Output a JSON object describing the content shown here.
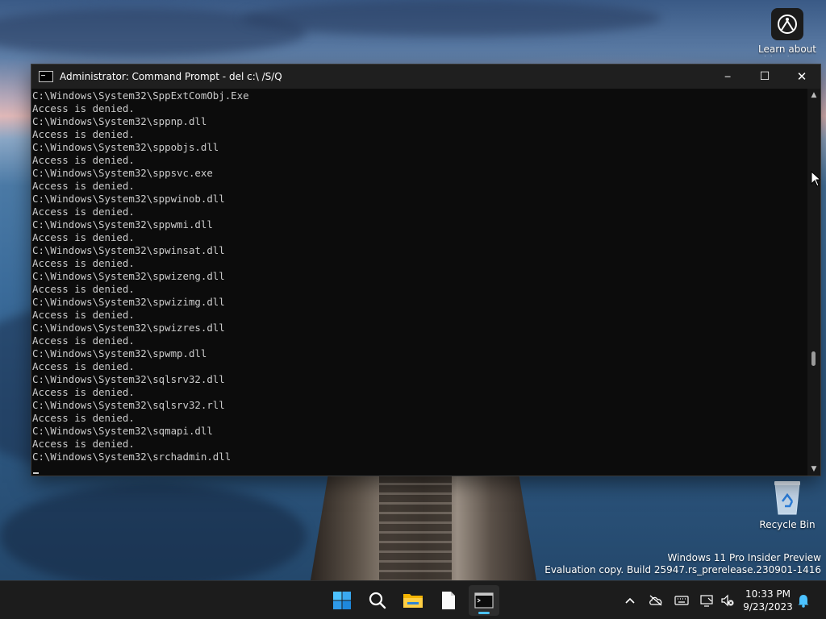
{
  "desktop": {
    "icons": [
      {
        "label": "Learn about this picture"
      },
      {
        "label": "Recycle Bin"
      }
    ],
    "watermark": {
      "line1": "Windows 11 Pro Insider Preview",
      "line2": "Evaluation copy. Build 25947.rs_prerelease.230901-1416"
    }
  },
  "window": {
    "title": "Administrator: Command Prompt - del  c:\\ /S/Q",
    "controls": {
      "minimize": "─",
      "maximize": "☐",
      "close": "✕"
    },
    "console_lines": [
      "C:\\Windows\\System32\\SppExtComObj.Exe",
      "Access is denied.",
      "C:\\Windows\\System32\\sppnp.dll",
      "Access is denied.",
      "C:\\Windows\\System32\\sppobjs.dll",
      "Access is denied.",
      "C:\\Windows\\System32\\sppsvc.exe",
      "Access is denied.",
      "C:\\Windows\\System32\\sppwinob.dll",
      "Access is denied.",
      "C:\\Windows\\System32\\sppwmi.dll",
      "Access is denied.",
      "C:\\Windows\\System32\\spwinsat.dll",
      "Access is denied.",
      "C:\\Windows\\System32\\spwizeng.dll",
      "Access is denied.",
      "C:\\Windows\\System32\\spwizimg.dll",
      "Access is denied.",
      "C:\\Windows\\System32\\spwizres.dll",
      "Access is denied.",
      "C:\\Windows\\System32\\spwmp.dll",
      "Access is denied.",
      "C:\\Windows\\System32\\sqlsrv32.dll",
      "Access is denied.",
      "C:\\Windows\\System32\\sqlsrv32.rll",
      "Access is denied.",
      "C:\\Windows\\System32\\sqmapi.dll",
      "Access is denied.",
      "C:\\Windows\\System32\\srchadmin.dll"
    ],
    "scroll_position": 0.72
  },
  "taskbar": {
    "apps": [
      {
        "icon": "windows-start-icon"
      },
      {
        "icon": "search-icon"
      },
      {
        "icon": "file-explorer-icon"
      },
      {
        "icon": "notepad-icon"
      },
      {
        "icon": "command-prompt-icon",
        "active": true
      }
    ],
    "tray": {
      "icons": [
        "chevron-up-icon",
        "onedrive-offline-icon",
        "keyboard-icon",
        "network-icon",
        "volume-muted-icon",
        "notification-bell-icon"
      ],
      "time": "10:33 PM",
      "date": "9/23/2023"
    },
    "accent_color": "#4cc2ff"
  }
}
